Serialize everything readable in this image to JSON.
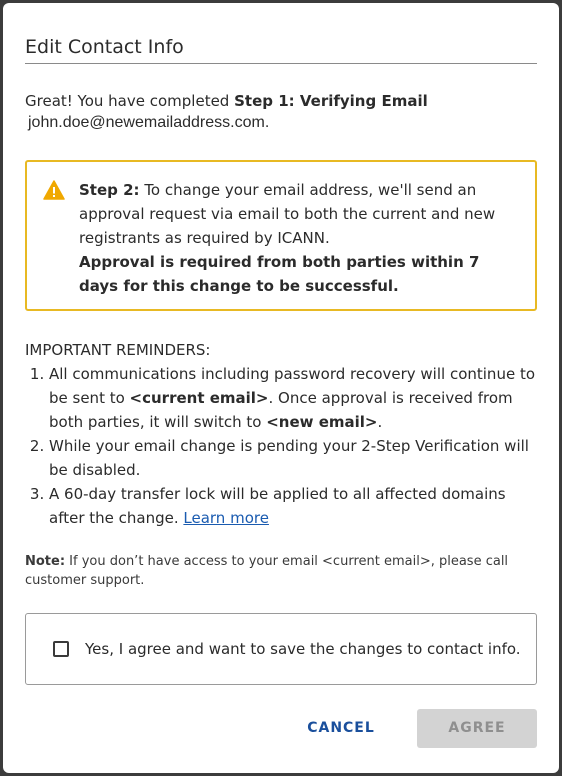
{
  "dialog": {
    "title": "Edit Contact Info"
  },
  "intro": {
    "prefix": "Great! You have completed ",
    "step_label": "Step 1: Verifying Email",
    "email": "john.doe@newemailaddress.com",
    "suffix": "."
  },
  "warning": {
    "icon": "warning-triangle-icon",
    "accent_color": "#e8b923",
    "step_label": "Step 2:",
    "text": " To change your email address, we'll send an approval request via email to both the current and new registrants as required by ICANN.",
    "bold_text": "Approval is required from both parties within 7 days for this change to be successful."
  },
  "reminders": {
    "heading": "IMPORTANT REMINDERS:",
    "item1": {
      "part1": "All communications including password recovery will continue to be sent to ",
      "bold1": "<current email>",
      "part2": ". Once approval is received from both parties, it will switch to ",
      "bold2": "<new email>",
      "part3": "."
    },
    "item2": "While your email change is pending your 2-Step Verification will be disabled.",
    "item3": {
      "text": "A 60-day transfer lock will be applied to all affected domains after the change. ",
      "link": "Learn more"
    }
  },
  "note": {
    "label": "Note:",
    "text": " If you don’t have access to your email <current email>, please call customer support."
  },
  "agreement": {
    "checked": false,
    "label": "Yes, I agree and want to save the changes to contact info."
  },
  "buttons": {
    "cancel": "CANCEL",
    "agree": "AGREE",
    "link_color": "#1a4f9c",
    "disabled_bg": "#d3d3d3"
  }
}
